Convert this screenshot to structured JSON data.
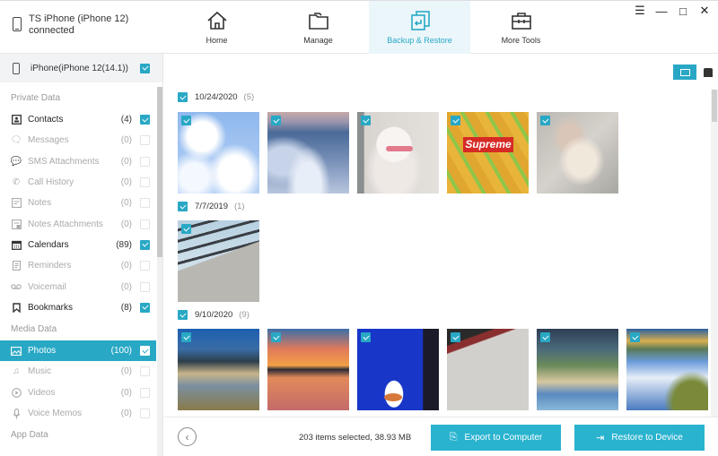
{
  "header": {
    "device_name": "TS iPhone (iPhone 12)",
    "device_status": "connected",
    "nav": [
      {
        "label": "Home",
        "icon": "home-icon",
        "active": false
      },
      {
        "label": "Manage",
        "icon": "folder-icon",
        "active": false
      },
      {
        "label": "Backup & Restore",
        "icon": "backup-restore-icon",
        "active": true
      },
      {
        "label": "More Tools",
        "icon": "toolbox-icon",
        "active": false
      }
    ],
    "window_controls": [
      "menu-icon",
      "minimize-icon",
      "maximize-icon",
      "close-icon"
    ]
  },
  "sidebar": {
    "device_row": {
      "label": "iPhone(iPhone 12(14.1))",
      "checked": true
    },
    "sections": [
      {
        "title": "Private Data",
        "items": [
          {
            "label": "Contacts",
            "count": "(4)",
            "checked": true,
            "enabled": true,
            "icon": "contacts-icon"
          },
          {
            "label": "Messages",
            "count": "(0)",
            "checked": false,
            "enabled": false,
            "icon": "message-icon"
          },
          {
            "label": "SMS Attachments",
            "count": "(0)",
            "checked": false,
            "enabled": false,
            "icon": "sms-attachment-icon"
          },
          {
            "label": "Call History",
            "count": "(0)",
            "checked": false,
            "enabled": false,
            "icon": "call-history-icon"
          },
          {
            "label": "Notes",
            "count": "(0)",
            "checked": false,
            "enabled": false,
            "icon": "notes-icon"
          },
          {
            "label": "Notes Attachments",
            "count": "(0)",
            "checked": false,
            "enabled": false,
            "icon": "notes-attachment-icon"
          },
          {
            "label": "Calendars",
            "count": "(89)",
            "checked": true,
            "enabled": true,
            "icon": "calendar-icon"
          },
          {
            "label": "Reminders",
            "count": "(0)",
            "checked": false,
            "enabled": false,
            "icon": "reminder-icon"
          },
          {
            "label": "Voicemail",
            "count": "(0)",
            "checked": false,
            "enabled": false,
            "icon": "voicemail-icon"
          },
          {
            "label": "Bookmarks",
            "count": "(8)",
            "checked": true,
            "enabled": true,
            "icon": "bookmark-icon"
          }
        ]
      },
      {
        "title": "Media Data",
        "items": [
          {
            "label": "Photos",
            "count": "(100)",
            "checked": true,
            "enabled": true,
            "selected": true,
            "icon": "photo-icon"
          },
          {
            "label": "Music",
            "count": "(0)",
            "checked": false,
            "enabled": false,
            "icon": "music-icon"
          },
          {
            "label": "Videos",
            "count": "(0)",
            "checked": false,
            "enabled": false,
            "icon": "video-icon"
          },
          {
            "label": "Voice Memos",
            "count": "(0)",
            "checked": false,
            "enabled": false,
            "icon": "microphone-icon"
          }
        ]
      },
      {
        "title": "App Data",
        "items": []
      }
    ]
  },
  "main": {
    "groups": [
      {
        "date": "10/24/2020",
        "count": "(5)",
        "checked": true,
        "photos": [
          "sky-clouds",
          "cloud-sea",
          "white-kitten",
          "supreme-pattern",
          "crane-painting"
        ]
      },
      {
        "date": "7/7/2019",
        "count": "(1)",
        "checked": true,
        "photos": [
          "building-corner"
        ]
      },
      {
        "date": "9/10/2020",
        "count": "(9)",
        "checked": true,
        "photos": [
          "mountain-lake",
          "sunset-lake",
          "blue-screen-duck",
          "cable-desk",
          "reflection-lake",
          "autumn-lake"
        ]
      }
    ]
  },
  "footer": {
    "status": "203 items selected, 38.93 MB",
    "export_label": "Export to Computer",
    "restore_label": "Restore to Device"
  },
  "colors": {
    "accent": "#29a8c5",
    "button": "#29b3cf"
  }
}
